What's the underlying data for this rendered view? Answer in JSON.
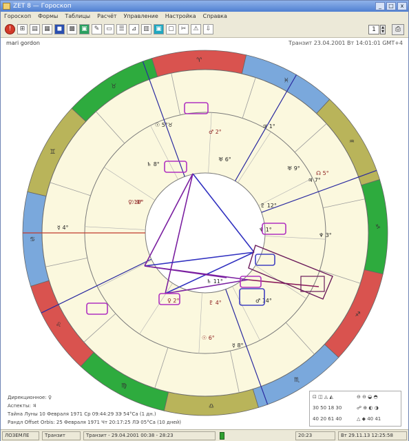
{
  "window": {
    "title": "ZET 8 — Гороскоп",
    "close_glyph": "x",
    "min_glyph": "_",
    "max_glyph": "□"
  },
  "menu": [
    "Гороскоп",
    "Формы",
    "Таблицы",
    "Расчёт",
    "Управление",
    "Настройка",
    "Справка"
  ],
  "toolbar": {
    "zoom_value": "1"
  },
  "chart": {
    "person_name": "mari gordon",
    "transit_label": "Транзит 23.04.2001  Вт 14:01:01 GMT+4",
    "sign_glyphs": [
      "♈",
      "♉",
      "♊",
      "♋",
      "♌",
      "♍",
      "♎",
      "♏",
      "♐",
      "♑",
      "♒",
      "♓"
    ],
    "planet_labels": [
      "☉ 5°♉",
      "♂ 2°",
      "♄ 8°",
      "♃ 1°",
      "♀ 10°",
      "☿ 4°",
      "♅ 6°",
      "☽ 9°",
      "♇ 12°",
      "♆ 3°",
      "☊ 5°",
      "♃ 7°",
      "♄ 11°",
      "♀ 2°",
      "♂ 14°",
      "☿ 8°",
      "☉ 6°",
      "♅ 9°",
      "♆ 1°",
      "♇ 4°"
    ]
  },
  "info": {
    "line1": "Дирекционное: ♀",
    "line2": "Аспекты: ♃",
    "line3": "Тайна Луны 10 Февраля 1971 Ср 09:44:29 ЗЭ 54°Ca (1 дн.)",
    "line4": "Рандл Offset Orbis: 25 Февраля 1971 Чт 20:17:25 ЛЭ 05°Ca (10 дней)"
  },
  "legend": {
    "r1a": "⊡ ◫ ◬ ◭",
    "r1b": "⊖ ⊖ ◒ ◓",
    "r2a": "30 50 18 30",
    "r2b": "☍ ⊕ ◐ ◑",
    "r3a": "40 20 61 40",
    "r3b": "△ ◆ 40 41"
  },
  "status": {
    "s1": "ЛОЗЕМЛЕ",
    "s2": "Транзит",
    "s3": "Транзит - 29.04.2001 00:38 - 28:23",
    "s4": "20:23",
    "s5": "Вт 29.11.13 12:25:58"
  }
}
